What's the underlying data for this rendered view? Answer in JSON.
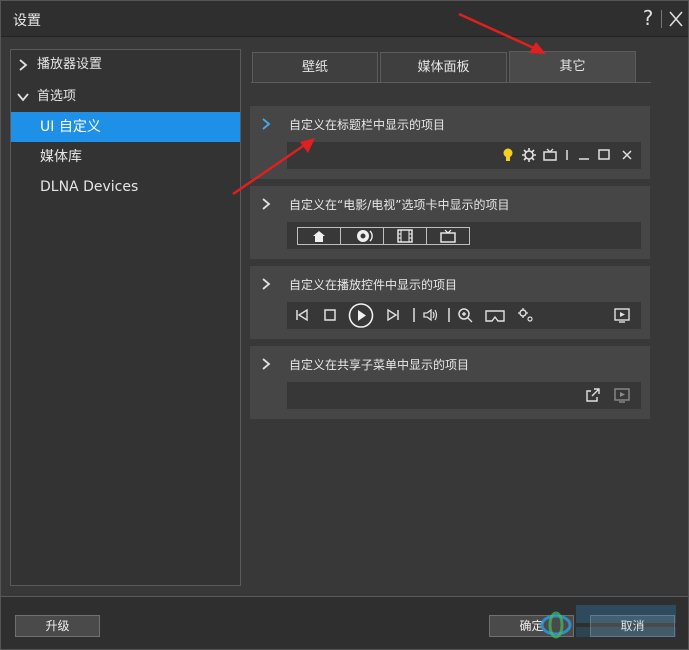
{
  "window": {
    "title": "设置",
    "help_glyph": "?"
  },
  "sidebar": {
    "groups": [
      {
        "label": "播放器设置",
        "expanded": false
      },
      {
        "label": "首选项",
        "expanded": true
      }
    ],
    "items": [
      {
        "label": "UI 自定义",
        "active": true
      },
      {
        "label": "媒体库",
        "active": false
      },
      {
        "label": "DLNA Devices",
        "active": false
      }
    ]
  },
  "tabs": [
    {
      "label": "壁纸",
      "active": false
    },
    {
      "label": "媒体面板",
      "active": false
    },
    {
      "label": "其它",
      "active": true
    }
  ],
  "sections": [
    {
      "title": "自定义在标题栏中显示的项目",
      "icons": [
        "bulb-icon",
        "gear-icon",
        "tv-icon",
        "divider-icon",
        "minimize-icon",
        "maximize-icon",
        "close-icon"
      ]
    },
    {
      "title": "自定义在“电影/电视”选项卡中显示的项目",
      "icons": [
        "home-icon",
        "disc-icon",
        "film-icon",
        "tv-icon"
      ]
    },
    {
      "title": "自定义在播放控件中显示的项目",
      "icons": [
        "skip-back-icon",
        "stop-icon",
        "play-icon",
        "skip-forward-icon",
        "divider-icon",
        "volume-icon",
        "divider-icon",
        "zoom-icon",
        "vr-icon",
        "settings-gears-icon",
        "cast-icon"
      ]
    },
    {
      "title": "自定义在共享子菜单中显示的项目",
      "icons": [
        "share-external-icon",
        "cast-icon"
      ]
    }
  ],
  "footer": {
    "upgrade_label": "升级",
    "ok_label": "确定",
    "cancel_label": "取消"
  },
  "colors": {
    "accent": "#1e90e8",
    "annotation_arrow": "#e02020",
    "bulb": "#f5d020"
  }
}
